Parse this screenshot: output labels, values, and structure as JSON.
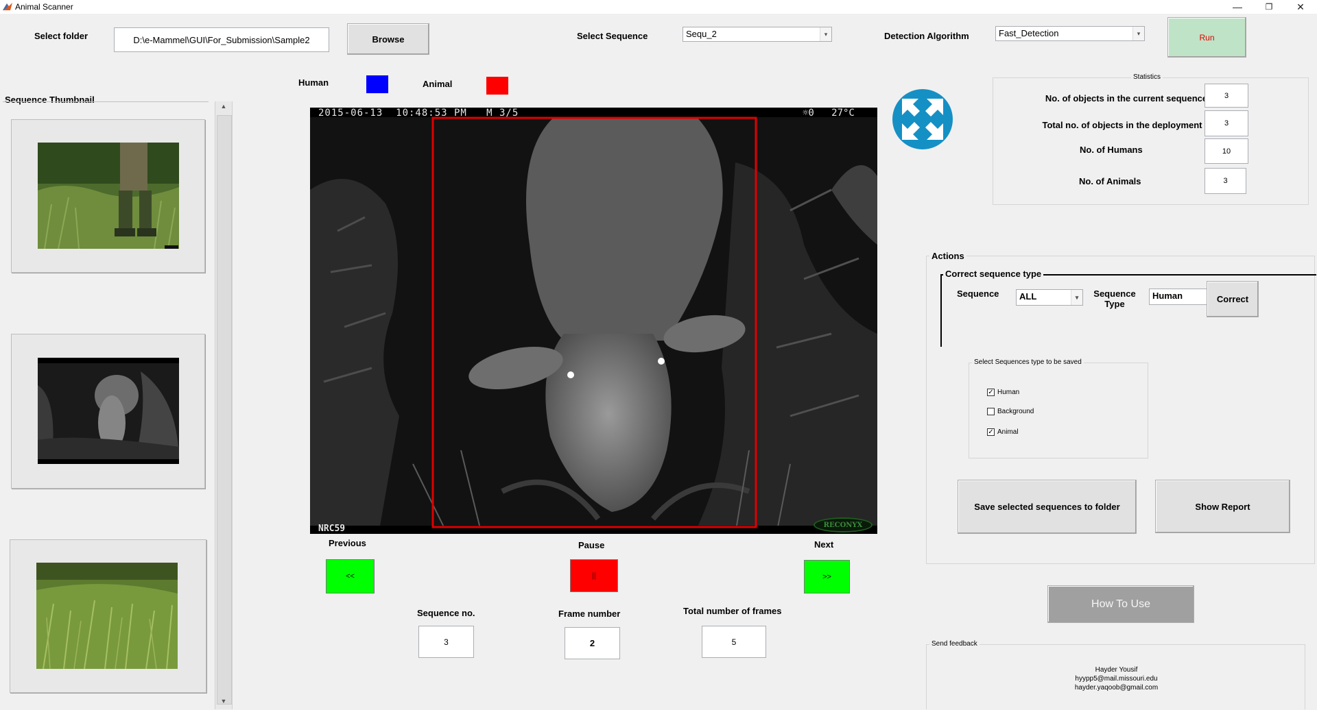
{
  "window": {
    "title": "Animal Scanner",
    "minimize_glyph": "—",
    "restore_glyph": "❐",
    "close_glyph": "✕"
  },
  "toolbar": {
    "select_folder_label": "Select folder",
    "folder_path": "D:\\e-Mammel\\GUI\\For_Submission\\Sample2",
    "browse_label": "Browse",
    "select_sequence_label": "Select Sequence",
    "sequence_value": "Sequ_2",
    "detection_algorithm_label": "Detection Algorithm",
    "algorithm_value": "Fast_Detection",
    "run_label": "Run"
  },
  "legend": {
    "human_label": "Human",
    "human_color": "#0000ff",
    "animal_label": "Animal",
    "animal_color": "#ff0000"
  },
  "thumbnails": {
    "title": "Sequence Thumbnail"
  },
  "viewer": {
    "overlay_datetime": "2015-06-13  10:48:53 PM   M 3/5",
    "overlay_temp": "☼0   27°C",
    "overlay_camera": "NRC59",
    "overlay_brand": "RECONYX",
    "box_color": "#e00000"
  },
  "playback": {
    "previous_label": "Previous",
    "previous_button": "<<",
    "pause_label": "Pause",
    "pause_button": "||",
    "next_label": "Next",
    "next_button": ">>"
  },
  "counters": {
    "sequence_no_label": "Sequence no.",
    "sequence_no": "3",
    "frame_number_label": "Frame number",
    "frame_number": "2",
    "total_frames_label": "Total number of frames",
    "total_frames": "5"
  },
  "statistics": {
    "title": "Statistics",
    "current_label": "No. of objects in the current sequence",
    "current_value": "3",
    "total_label": "Total no. of objects in the deployment",
    "total_value": "3",
    "humans_label": "No. of Humans",
    "humans_value": "10",
    "animals_label": "No. of Animals",
    "animals_value": "3"
  },
  "actions": {
    "title": "Actions",
    "correct_title": "Correct sequence type",
    "sequence_label": "Sequence",
    "sequence_value": "ALL",
    "sequence_type_label_1": "Sequence",
    "sequence_type_label_2": "Type",
    "sequence_type_value": "Human",
    "correct_button": "Correct",
    "save_types_title": "Select Sequences type to be saved",
    "checkboxes": [
      {
        "label": "Human",
        "checked": "✓"
      },
      {
        "label": "Background",
        "checked": ""
      },
      {
        "label": "Animal",
        "checked": "✓"
      }
    ],
    "save_button": "Save selected sequences to folder",
    "report_button": "Show Report"
  },
  "help": {
    "how_to_use": "How To Use"
  },
  "feedback": {
    "title": "Send feedback",
    "name": "Hayder Yousif",
    "email1": "hyypp5@mail.missouri.edu",
    "email2": "hayder.yaqoob@gmail.com"
  }
}
